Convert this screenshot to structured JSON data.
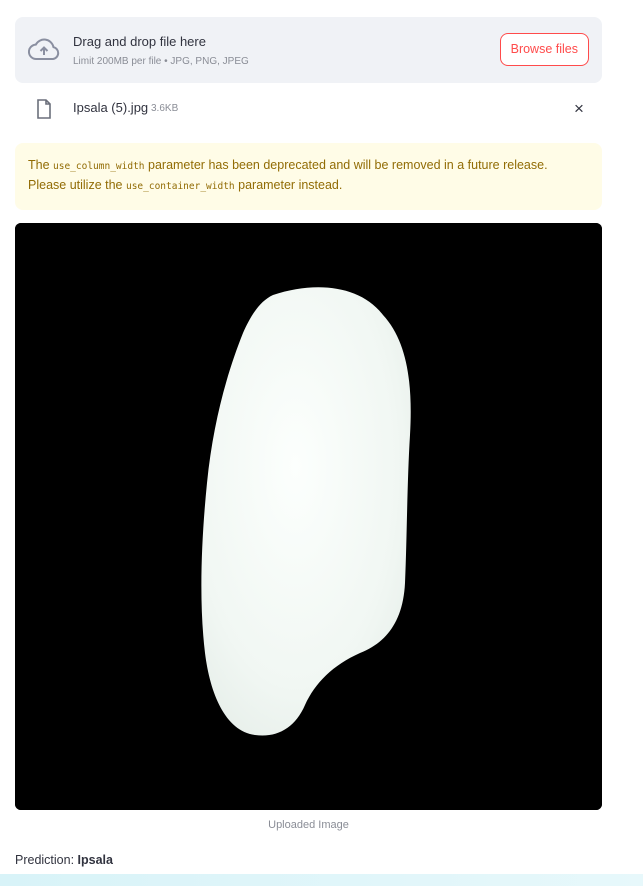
{
  "uploader": {
    "title": "Drag and drop file here",
    "subtitle": "Limit 200MB per file • JPG, PNG, JPEG",
    "browse_label": "Browse files",
    "icon": "cloud-upload-icon",
    "accent_color": "#ff4b4b"
  },
  "file": {
    "name": "Ipsala (5).jpg",
    "size": "3.6KB",
    "icon": "file-icon",
    "remove_icon": "close-icon",
    "remove_label": "×"
  },
  "warning": {
    "text_1": "The ",
    "code_1": "use_column_width",
    "text_2": " parameter has been deprecated and will be removed in a future release. Please utilize the ",
    "code_2": "use_container_width",
    "text_3": " parameter instead.",
    "background": "#fffce7",
    "text_color": "#926c05"
  },
  "image": {
    "caption": "Uploaded Image",
    "subject": "rice-grain"
  },
  "prediction": {
    "label": "Prediction: ",
    "value": "Ipsala"
  }
}
